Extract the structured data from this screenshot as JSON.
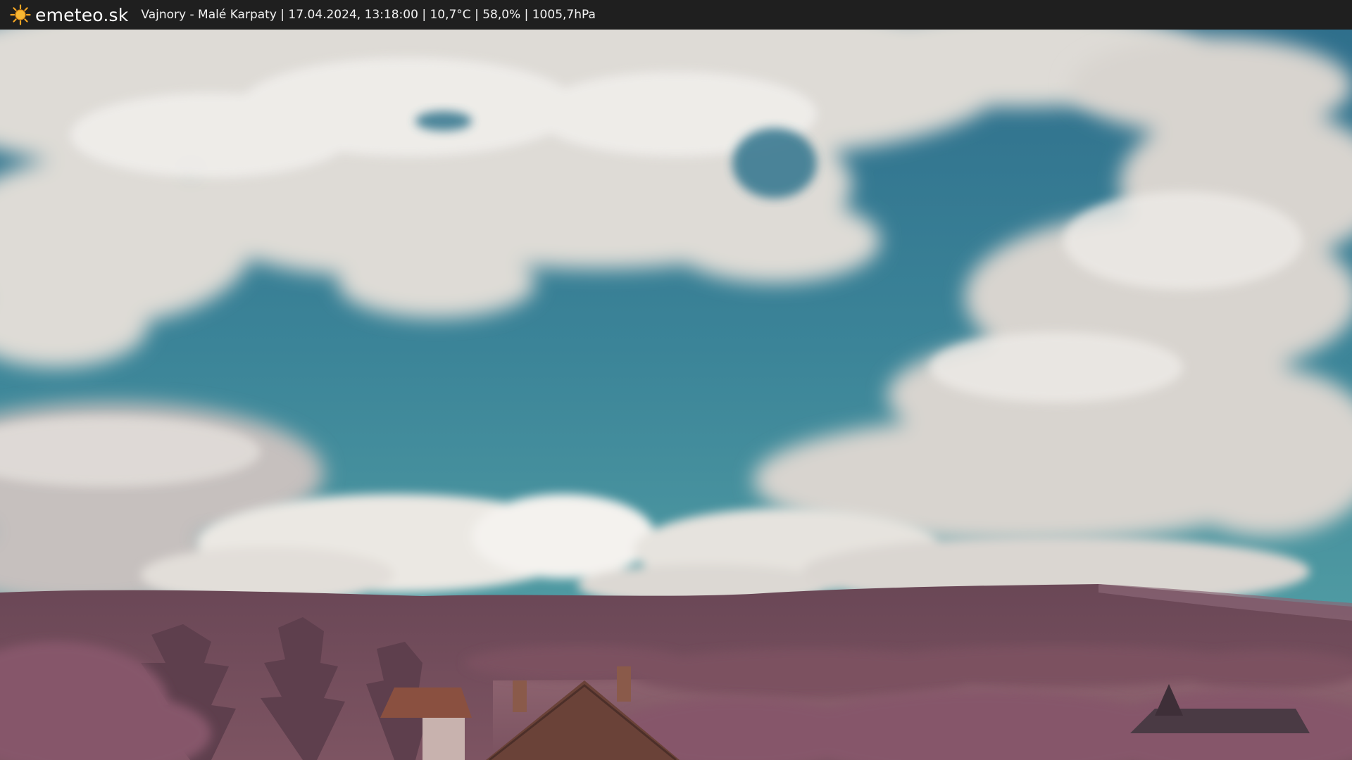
{
  "header": {
    "brand": "emeteo.sk",
    "caption": "Vajnory - Malé Karpaty | 17.04.2024, 13:18:00 | 10,7°C | 58,0% | 1005,7hPa"
  },
  "icons": {
    "logo": "sun-icon"
  },
  "colors": {
    "bar": "#1f1f1f",
    "sun": "#f5a623",
    "sky": "#3a8196",
    "cloud": "#e6e3dd",
    "hills": "#6e4a5a",
    "foliage": "#8a5a68"
  }
}
